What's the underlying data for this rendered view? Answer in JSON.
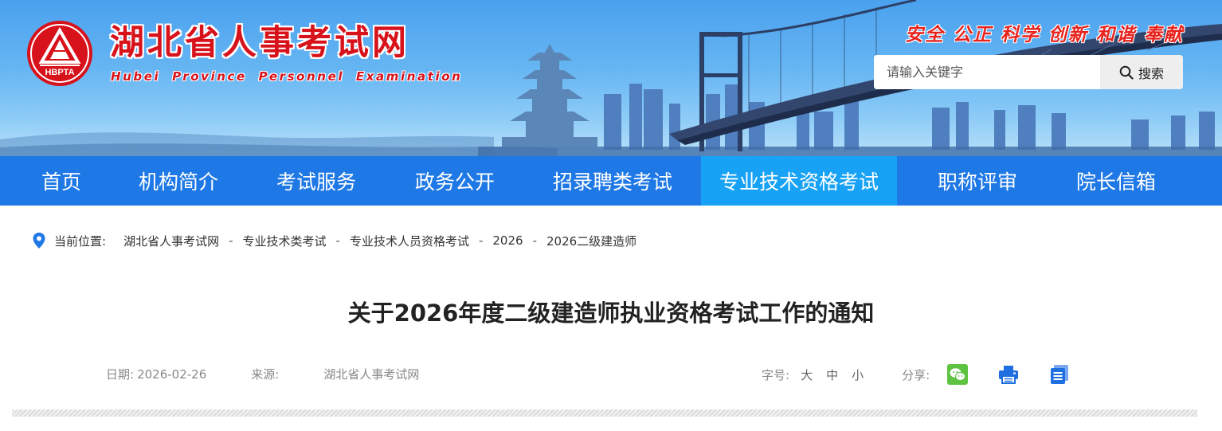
{
  "header": {
    "site_title": "湖北省人事考试网",
    "site_subtitle": "Hubei Province Personnel Examination",
    "logo_text": "HBPTA",
    "slogan": "安全 公正 科学 创新 和谐 奉献",
    "search": {
      "placeholder": "请输入关键字",
      "button_label": "搜索"
    }
  },
  "nav": {
    "items": [
      {
        "label": "首页"
      },
      {
        "label": "机构简介"
      },
      {
        "label": "考试服务"
      },
      {
        "label": "政务公开"
      },
      {
        "label": "招录聘类考试"
      },
      {
        "label": "专业技术资格考试",
        "active": true
      },
      {
        "label": "职称评审"
      },
      {
        "label": "院长信箱"
      }
    ]
  },
  "breadcrumb": {
    "label": "当前位置:",
    "items": [
      "湖北省人事考试网",
      "专业技术类考试",
      "专业技术人员资格考试",
      "2026",
      "2026二级建造师"
    ],
    "separator": "-"
  },
  "article": {
    "title": "关于2026年度二级建造师执业资格考试工作的通知",
    "date_label": "日期:",
    "date": "2026-02-26",
    "source_label": "来源:",
    "source": "湖北省人事考试网",
    "font_size_label": "字号:",
    "font_sizes": [
      "大",
      "中",
      "小"
    ],
    "share_label": "分享:"
  },
  "colors": {
    "nav_bg": "#1e78e5",
    "nav_active": "#18a2f6",
    "brand_red": "#d8121b",
    "wechat_green": "#5ec341",
    "icon_blue": "#1f6fe0"
  },
  "icons": [
    "location-pin-icon",
    "search-icon",
    "wechat-icon",
    "print-icon",
    "copy-icon"
  ]
}
